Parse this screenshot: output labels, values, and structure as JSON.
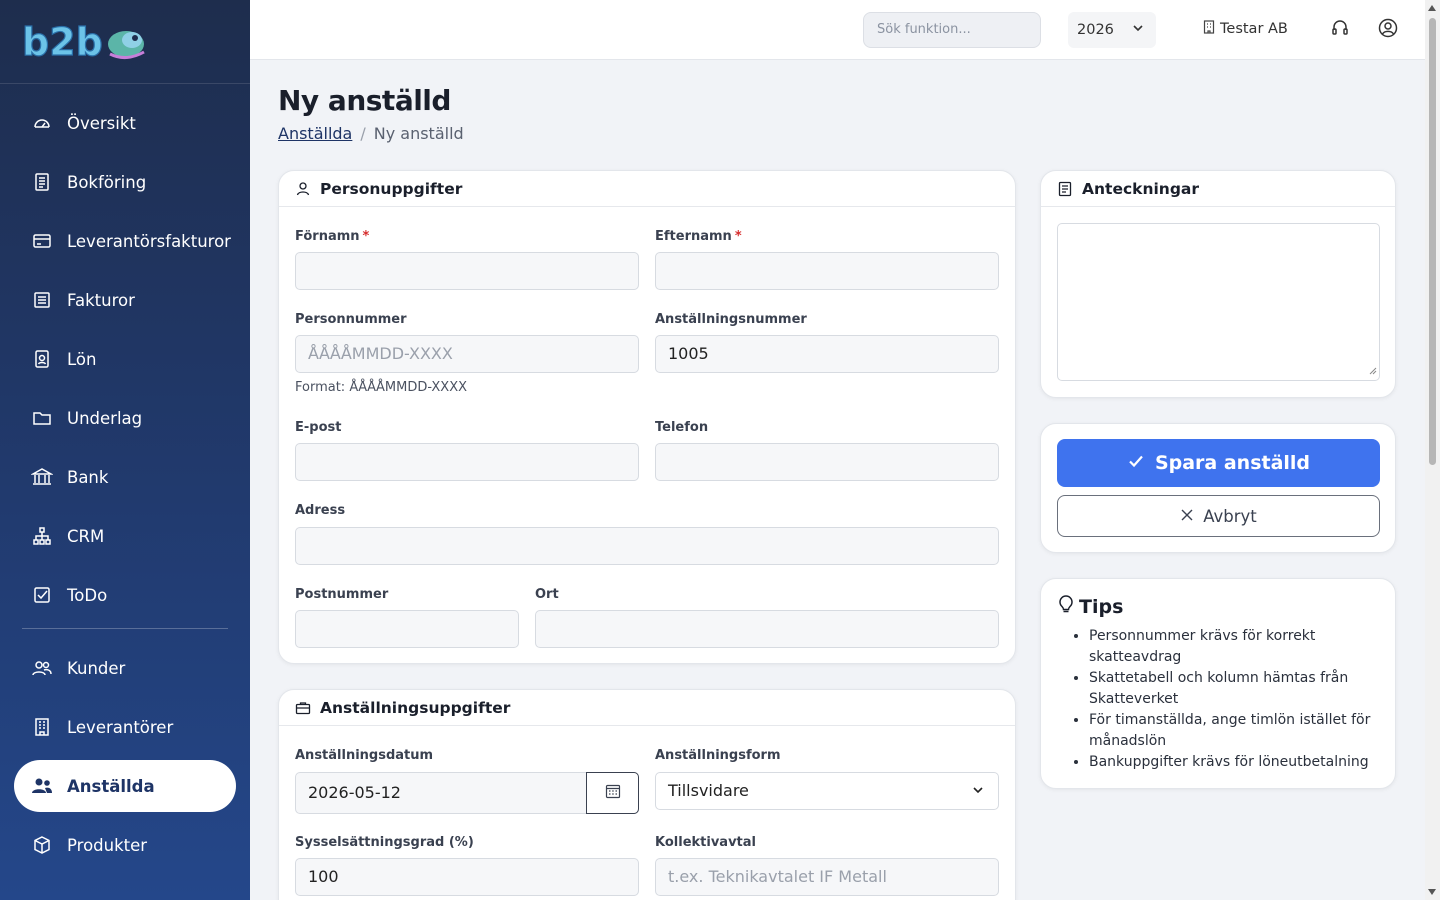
{
  "brand": {
    "logo_text": "b2b"
  },
  "sidebar": {
    "items": [
      {
        "label": "Översikt",
        "icon": "gauge-icon"
      },
      {
        "label": "Bokföring",
        "icon": "ledger-icon"
      },
      {
        "label": "Leverantörsfakturor",
        "icon": "card-icon"
      },
      {
        "label": "Fakturor",
        "icon": "invoice-icon"
      },
      {
        "label": "Lön",
        "icon": "badge-icon"
      },
      {
        "label": "Underlag",
        "icon": "folder-icon"
      },
      {
        "label": "Bank",
        "icon": "bank-icon"
      },
      {
        "label": "CRM",
        "icon": "network-icon"
      },
      {
        "label": "ToDo",
        "icon": "checkbox-icon"
      }
    ],
    "items2": [
      {
        "label": "Kunder",
        "icon": "users-icon"
      },
      {
        "label": "Leverantörer",
        "icon": "building-icon"
      },
      {
        "label": "Anställda",
        "icon": "people-icon",
        "active": true
      },
      {
        "label": "Produkter",
        "icon": "box-icon"
      }
    ]
  },
  "topbar": {
    "search_placeholder": "Sök funktion...",
    "year": "2026",
    "company": "Testar AB"
  },
  "page": {
    "title": "Ny anställd",
    "breadcrumb": {
      "parent": "Anställda",
      "current": "Ny anställd"
    }
  },
  "personal": {
    "title": "Personuppgifter",
    "first_name_label": "Förnamn",
    "last_name_label": "Efternamn",
    "required_mark": "*",
    "personnummer_label": "Personnummer",
    "personnummer_placeholder": "ÅÅÅÅMMDD-XXXX",
    "personnummer_hint": "Format: ÅÅÅÅMMDD-XXXX",
    "employee_number_label": "Anställningsnummer",
    "employee_number_value": "1005",
    "email_label": "E-post",
    "phone_label": "Telefon",
    "address_label": "Adress",
    "postal_label": "Postnummer",
    "city_label": "Ort"
  },
  "employment": {
    "title": "Anställningsuppgifter",
    "date_label": "Anställningsdatum",
    "date_value": "2026-05-12",
    "form_label": "Anställningsform",
    "form_value": "Tillsvidare",
    "degree_label": "Sysselsättningsgrad (%)",
    "degree_value": "100",
    "agreement_label": "Kollektivavtal",
    "agreement_placeholder": "t.ex. Teknikavtalet IF Metall"
  },
  "notes": {
    "title": "Anteckningar"
  },
  "actions": {
    "save_label": "Spara anställd",
    "cancel_label": "Avbryt"
  },
  "tips": {
    "title": "Tips",
    "items": [
      "Personnummer krävs för korrekt skatteavdrag",
      "Skattetabell och kolumn hämtas från Skatteverket",
      "För timanställda, ange timlön istället för månadslön",
      "Bankuppgifter krävs för löneutbetalning"
    ]
  },
  "colors": {
    "sidebar_top": "#1e2d4d",
    "sidebar_bottom": "#24478a",
    "primary": "#3f73ee",
    "required": "#d62d2d"
  }
}
